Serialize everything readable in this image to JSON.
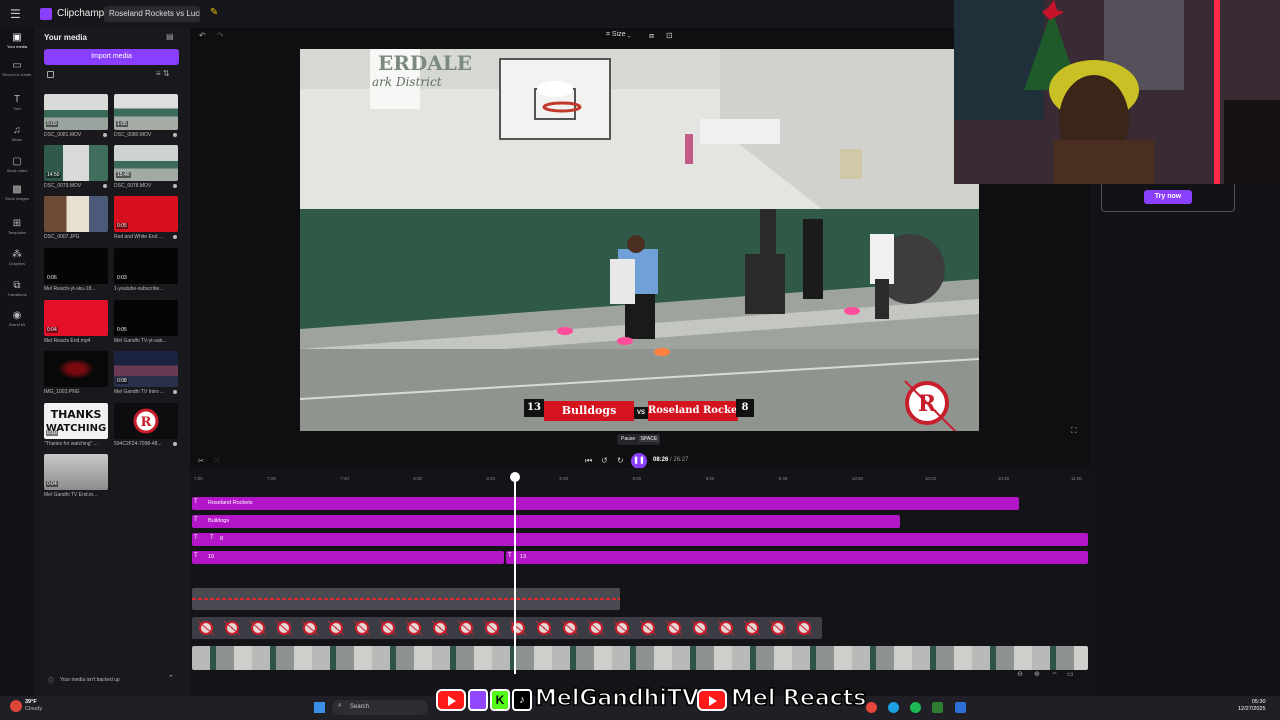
{
  "app": {
    "name": "Clipchamp",
    "project_tab": "Roseland Rockets vs Lucky L"
  },
  "rail": [
    {
      "label": "Your media",
      "icon": "folder-icon"
    },
    {
      "label": "Record & create",
      "icon": "camera-icon"
    },
    {
      "label": "Text",
      "icon": "text-icon"
    },
    {
      "label": "Music",
      "icon": "music-icon"
    },
    {
      "label": "Stock video",
      "icon": "stock-video-icon"
    },
    {
      "label": "Stock images",
      "icon": "stock-images-icon"
    },
    {
      "label": "Templates",
      "icon": "templates-icon"
    },
    {
      "label": "Graphics",
      "icon": "graphics-icon"
    },
    {
      "label": "Transitions",
      "icon": "transitions-icon"
    },
    {
      "label": "Brand kit",
      "icon": "brand-kit-icon"
    }
  ],
  "media": {
    "title": "Your media",
    "import_label": "Import media",
    "backup_text": "Your media isn't backed up",
    "items": [
      {
        "name": "DSC_0081.MOV",
        "duration": "5:09"
      },
      {
        "name": "DSC_0080.MOV",
        "duration": "1:05"
      },
      {
        "name": "DSC_0079.MOV",
        "duration": "14:50"
      },
      {
        "name": "DSC_0078.MOV",
        "duration": "15:40"
      },
      {
        "name": "DSC_0007.JPG",
        "duration": ""
      },
      {
        "name": "Red and White End ...",
        "duration": "0:05"
      },
      {
        "name": "Mel Reacts-yt-sku-18...",
        "duration": "0:06"
      },
      {
        "name": "1-youtube-subscribe...",
        "duration": "0:03"
      },
      {
        "name": "Mel Reacts End.mp4",
        "duration": "0:04"
      },
      {
        "name": "Mel Gandhi TV-yt-sub...",
        "duration": "0:05"
      },
      {
        "name": "IMG_1003.PNG",
        "duration": ""
      },
      {
        "name": "Mel Gandhi TV Intro ...",
        "duration": "0:08"
      },
      {
        "name": "\"Thanks for watching\" ...",
        "duration": "0:10"
      },
      {
        "name": "594C2F24-7098-48...",
        "duration": ""
      },
      {
        "name": "Mel Gandhi TV End.m...",
        "duration": "0:04"
      }
    ]
  },
  "preview": {
    "size_label": "Size",
    "scoreboard": {
      "home_score": "13",
      "home_team": "Bulldogs",
      "vs": "VS",
      "away_team": "Roseland Rockets",
      "away_score": "8"
    },
    "wall_text": "ERDALE",
    "wall_subtext": "ark District"
  },
  "webcam": {
    "cta": "Try now"
  },
  "playback": {
    "tooltip_action": "Pause",
    "tooltip_key": "SPACE",
    "current": "08:26",
    "total": "26:27",
    "play_icon": "pause-icon"
  },
  "timeline": {
    "ticks": [
      "7:00",
      "7:20",
      "7:40",
      "8:00",
      "8:20",
      "8:40",
      "9:00",
      "9:20",
      "9:40",
      "10:00",
      "10:20",
      "10:40",
      "11:00"
    ],
    "text_tracks": [
      {
        "label": "Roseland Rockets"
      },
      {
        "label": "Bulldogs"
      },
      {
        "label": "8"
      },
      {
        "label": "10",
        "label2": "13"
      }
    ]
  },
  "taskbar": {
    "weather_temp": "39°F",
    "weather_desc": "Cloudy",
    "search_placeholder": "Search",
    "time": "05:30",
    "date": "12/27/2025"
  },
  "overlay": {
    "channel1": "MelGandhiTV",
    "channel2": "Mel Reacts"
  },
  "colors": {
    "accent": "#8a3ffc",
    "track": "#b216c6",
    "scoreboard_red": "#d4131f"
  }
}
